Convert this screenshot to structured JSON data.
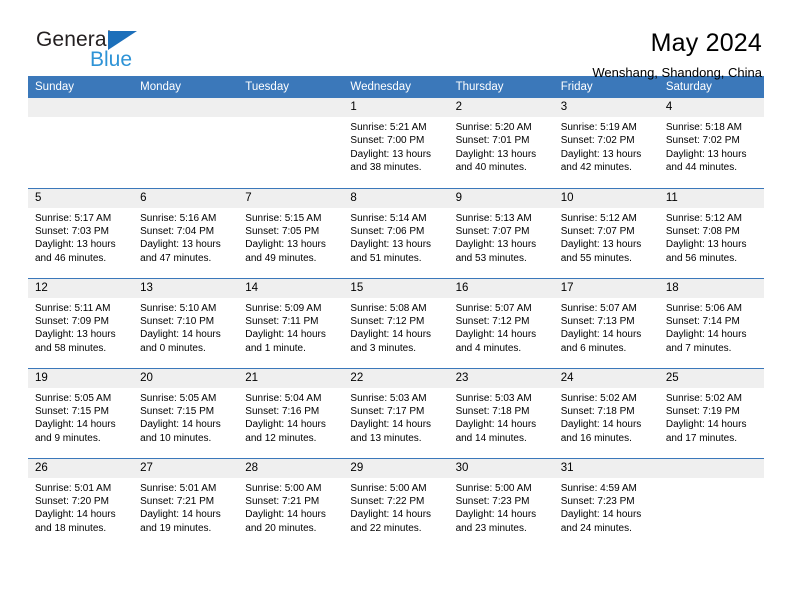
{
  "logo": {
    "word_top": "General",
    "word_bottom": "Blue",
    "triangle_icon": "triangle-icon",
    "color_dark": "#231f20",
    "color_blue": "#2e93d6",
    "color_triangle": "#1c6fba"
  },
  "header": {
    "title": "May 2024",
    "subtitle": "Wenshang, Shandong, China"
  },
  "theme": {
    "header_bg": "#3b78ba",
    "daynum_bg": "#efefef",
    "page_bg": "#ffffff",
    "text": "#000000"
  },
  "calendar": {
    "weekday_headers": [
      "Sunday",
      "Monday",
      "Tuesday",
      "Wednesday",
      "Thursday",
      "Friday",
      "Saturday"
    ],
    "weeks": [
      [
        {
          "day": "",
          "empty": true
        },
        {
          "day": "",
          "empty": true
        },
        {
          "day": "",
          "empty": true
        },
        {
          "day": "1",
          "sunrise": "Sunrise: 5:21 AM",
          "sunset": "Sunset: 7:00 PM",
          "daylight": "Daylight: 13 hours and 38 minutes."
        },
        {
          "day": "2",
          "sunrise": "Sunrise: 5:20 AM",
          "sunset": "Sunset: 7:01 PM",
          "daylight": "Daylight: 13 hours and 40 minutes."
        },
        {
          "day": "3",
          "sunrise": "Sunrise: 5:19 AM",
          "sunset": "Sunset: 7:02 PM",
          "daylight": "Daylight: 13 hours and 42 minutes."
        },
        {
          "day": "4",
          "sunrise": "Sunrise: 5:18 AM",
          "sunset": "Sunset: 7:02 PM",
          "daylight": "Daylight: 13 hours and 44 minutes."
        }
      ],
      [
        {
          "day": "5",
          "sunrise": "Sunrise: 5:17 AM",
          "sunset": "Sunset: 7:03 PM",
          "daylight": "Daylight: 13 hours and 46 minutes."
        },
        {
          "day": "6",
          "sunrise": "Sunrise: 5:16 AM",
          "sunset": "Sunset: 7:04 PM",
          "daylight": "Daylight: 13 hours and 47 minutes."
        },
        {
          "day": "7",
          "sunrise": "Sunrise: 5:15 AM",
          "sunset": "Sunset: 7:05 PM",
          "daylight": "Daylight: 13 hours and 49 minutes."
        },
        {
          "day": "8",
          "sunrise": "Sunrise: 5:14 AM",
          "sunset": "Sunset: 7:06 PM",
          "daylight": "Daylight: 13 hours and 51 minutes."
        },
        {
          "day": "9",
          "sunrise": "Sunrise: 5:13 AM",
          "sunset": "Sunset: 7:07 PM",
          "daylight": "Daylight: 13 hours and 53 minutes."
        },
        {
          "day": "10",
          "sunrise": "Sunrise: 5:12 AM",
          "sunset": "Sunset: 7:07 PM",
          "daylight": "Daylight: 13 hours and 55 minutes."
        },
        {
          "day": "11",
          "sunrise": "Sunrise: 5:12 AM",
          "sunset": "Sunset: 7:08 PM",
          "daylight": "Daylight: 13 hours and 56 minutes."
        }
      ],
      [
        {
          "day": "12",
          "sunrise": "Sunrise: 5:11 AM",
          "sunset": "Sunset: 7:09 PM",
          "daylight": "Daylight: 13 hours and 58 minutes."
        },
        {
          "day": "13",
          "sunrise": "Sunrise: 5:10 AM",
          "sunset": "Sunset: 7:10 PM",
          "daylight": "Daylight: 14 hours and 0 minutes."
        },
        {
          "day": "14",
          "sunrise": "Sunrise: 5:09 AM",
          "sunset": "Sunset: 7:11 PM",
          "daylight": "Daylight: 14 hours and 1 minute."
        },
        {
          "day": "15",
          "sunrise": "Sunrise: 5:08 AM",
          "sunset": "Sunset: 7:12 PM",
          "daylight": "Daylight: 14 hours and 3 minutes."
        },
        {
          "day": "16",
          "sunrise": "Sunrise: 5:07 AM",
          "sunset": "Sunset: 7:12 PM",
          "daylight": "Daylight: 14 hours and 4 minutes."
        },
        {
          "day": "17",
          "sunrise": "Sunrise: 5:07 AM",
          "sunset": "Sunset: 7:13 PM",
          "daylight": "Daylight: 14 hours and 6 minutes."
        },
        {
          "day": "18",
          "sunrise": "Sunrise: 5:06 AM",
          "sunset": "Sunset: 7:14 PM",
          "daylight": "Daylight: 14 hours and 7 minutes."
        }
      ],
      [
        {
          "day": "19",
          "sunrise": "Sunrise: 5:05 AM",
          "sunset": "Sunset: 7:15 PM",
          "daylight": "Daylight: 14 hours and 9 minutes."
        },
        {
          "day": "20",
          "sunrise": "Sunrise: 5:05 AM",
          "sunset": "Sunset: 7:15 PM",
          "daylight": "Daylight: 14 hours and 10 minutes."
        },
        {
          "day": "21",
          "sunrise": "Sunrise: 5:04 AM",
          "sunset": "Sunset: 7:16 PM",
          "daylight": "Daylight: 14 hours and 12 minutes."
        },
        {
          "day": "22",
          "sunrise": "Sunrise: 5:03 AM",
          "sunset": "Sunset: 7:17 PM",
          "daylight": "Daylight: 14 hours and 13 minutes."
        },
        {
          "day": "23",
          "sunrise": "Sunrise: 5:03 AM",
          "sunset": "Sunset: 7:18 PM",
          "daylight": "Daylight: 14 hours and 14 minutes."
        },
        {
          "day": "24",
          "sunrise": "Sunrise: 5:02 AM",
          "sunset": "Sunset: 7:18 PM",
          "daylight": "Daylight: 14 hours and 16 minutes."
        },
        {
          "day": "25",
          "sunrise": "Sunrise: 5:02 AM",
          "sunset": "Sunset: 7:19 PM",
          "daylight": "Daylight: 14 hours and 17 minutes."
        }
      ],
      [
        {
          "day": "26",
          "sunrise": "Sunrise: 5:01 AM",
          "sunset": "Sunset: 7:20 PM",
          "daylight": "Daylight: 14 hours and 18 minutes."
        },
        {
          "day": "27",
          "sunrise": "Sunrise: 5:01 AM",
          "sunset": "Sunset: 7:21 PM",
          "daylight": "Daylight: 14 hours and 19 minutes."
        },
        {
          "day": "28",
          "sunrise": "Sunrise: 5:00 AM",
          "sunset": "Sunset: 7:21 PM",
          "daylight": "Daylight: 14 hours and 20 minutes."
        },
        {
          "day": "29",
          "sunrise": "Sunrise: 5:00 AM",
          "sunset": "Sunset: 7:22 PM",
          "daylight": "Daylight: 14 hours and 22 minutes."
        },
        {
          "day": "30",
          "sunrise": "Sunrise: 5:00 AM",
          "sunset": "Sunset: 7:23 PM",
          "daylight": "Daylight: 14 hours and 23 minutes."
        },
        {
          "day": "31",
          "sunrise": "Sunrise: 4:59 AM",
          "sunset": "Sunset: 7:23 PM",
          "daylight": "Daylight: 14 hours and 24 minutes."
        },
        {
          "day": "",
          "empty": true
        }
      ]
    ]
  }
}
